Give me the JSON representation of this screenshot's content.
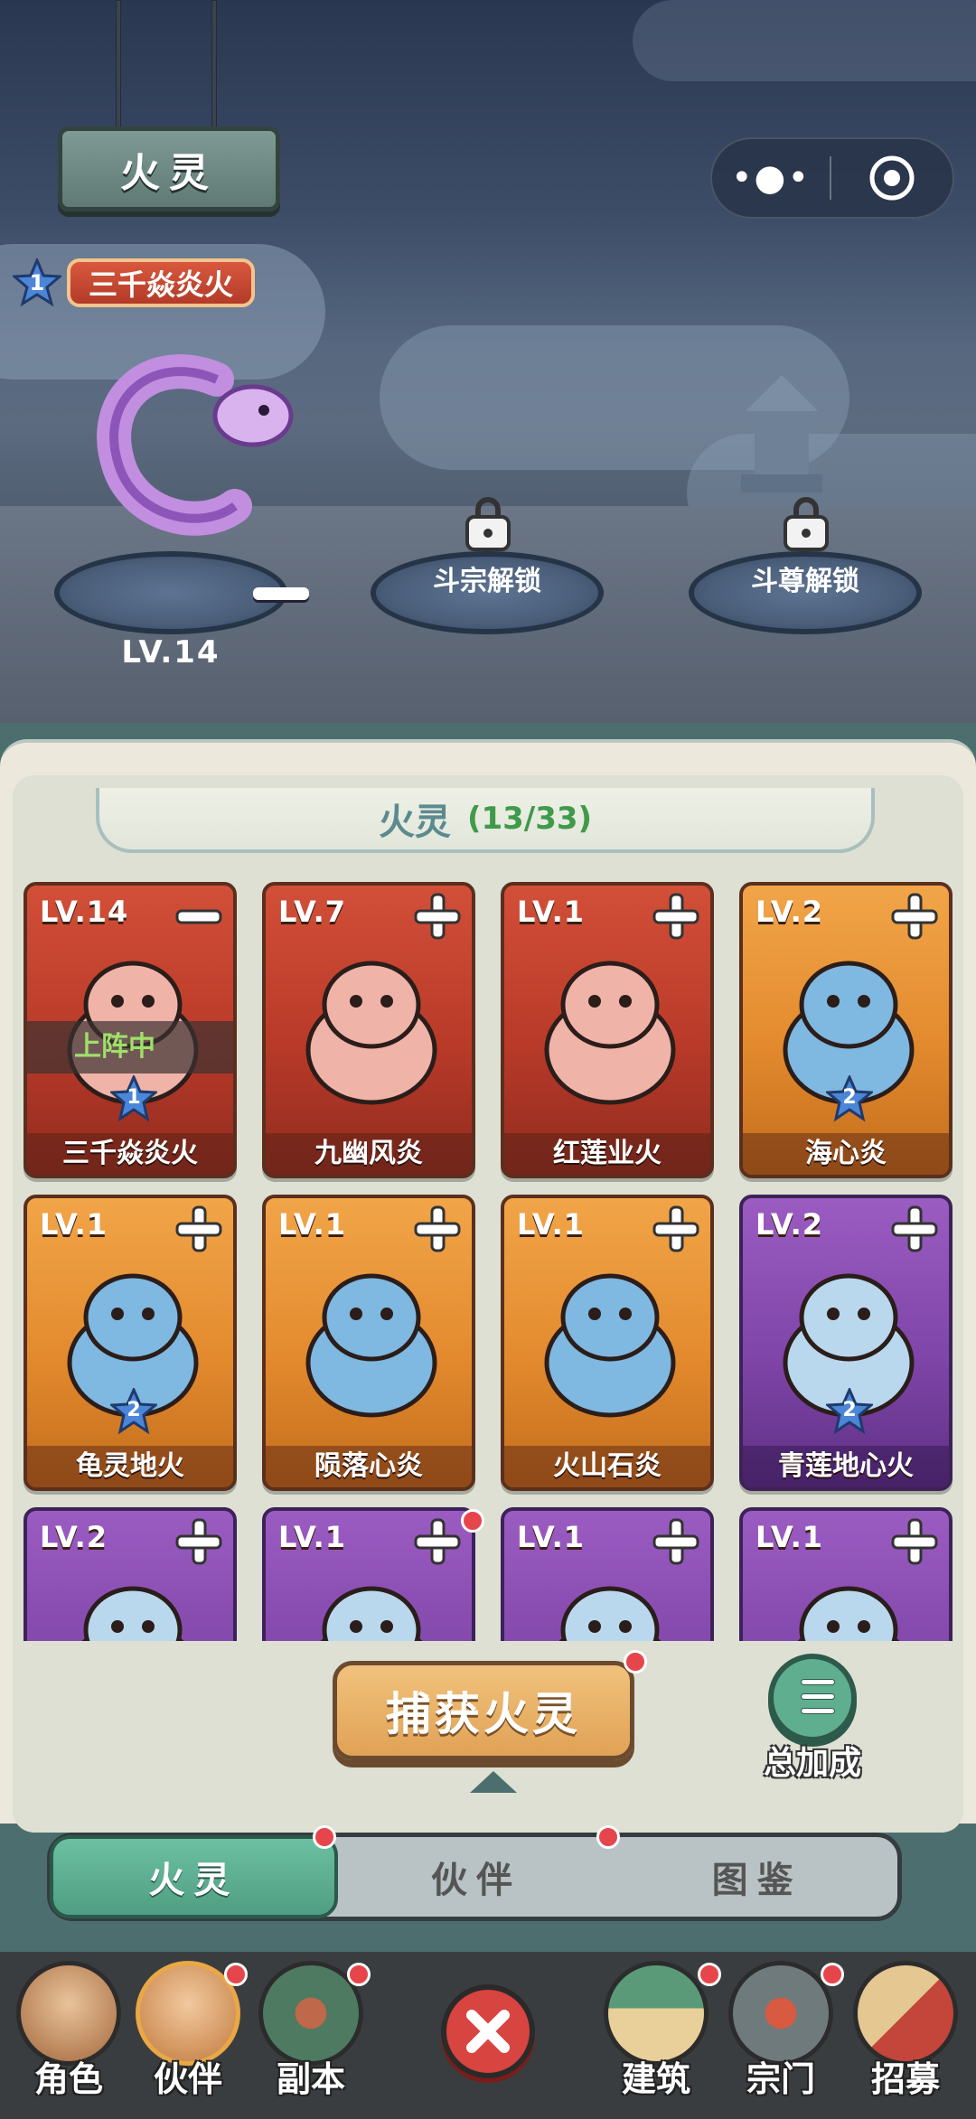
{
  "scene": {
    "sign_title": "火灵",
    "capsule": {
      "more_icon": "more-dots-icon",
      "close_icon": "target-circle-icon"
    },
    "active_fire": {
      "star": "1",
      "name": "三千焱炎火"
    },
    "slots": [
      {
        "label": "LV.14",
        "state": "occupied"
      },
      {
        "label": "斗宗解锁",
        "state": "locked"
      },
      {
        "label": "斗尊解锁",
        "state": "locked"
      }
    ]
  },
  "panel": {
    "title": "火灵",
    "count": "(13/33)",
    "deploy_label": "上阵中",
    "cards": [
      {
        "level": "LV.14",
        "name": "三千焱炎火",
        "star": "1",
        "color": "red",
        "action": "minus",
        "deployed": true
      },
      {
        "level": "LV.7",
        "name": "九幽风炎",
        "star": "",
        "color": "red",
        "action": "plus"
      },
      {
        "level": "LV.1",
        "name": "红莲业火",
        "star": "",
        "color": "red",
        "action": "plus"
      },
      {
        "level": "LV.2",
        "name": "海心炎",
        "star": "2",
        "color": "orange",
        "action": "plus"
      },
      {
        "level": "LV.1",
        "name": "龟灵地火",
        "star": "2",
        "color": "orange",
        "action": "plus"
      },
      {
        "level": "LV.1",
        "name": "陨落心炎",
        "star": "",
        "color": "orange",
        "action": "plus"
      },
      {
        "level": "LV.1",
        "name": "火山石炎",
        "star": "",
        "color": "orange",
        "action": "plus"
      },
      {
        "level": "LV.2",
        "name": "青莲地心火",
        "star": "2",
        "color": "purple",
        "action": "plus"
      },
      {
        "level": "LV.2",
        "name": "",
        "star": "",
        "color": "purple",
        "action": "plus"
      },
      {
        "level": "LV.1",
        "name": "",
        "star": "",
        "color": "purple",
        "action": "plus"
      },
      {
        "level": "LV.1",
        "name": "",
        "star": "",
        "color": "purple",
        "action": "plus"
      },
      {
        "level": "LV.1",
        "name": "",
        "star": "",
        "color": "purple",
        "action": "plus"
      }
    ],
    "capture_button": "捕获火灵",
    "bonus_button": "总加成",
    "tabs": [
      "火灵",
      "伙伴",
      "图鉴"
    ]
  },
  "navbar": {
    "items": [
      "角色",
      "伙伴",
      "副本",
      "建筑",
      "宗门",
      "招募"
    ],
    "close_icon": "close-x-icon"
  },
  "colors": {
    "red_card": "#c2412d",
    "orange_card": "#e68f33",
    "purple_card": "#874bae",
    "accent_green": "#5fae8f",
    "notify": "#e6464b"
  }
}
